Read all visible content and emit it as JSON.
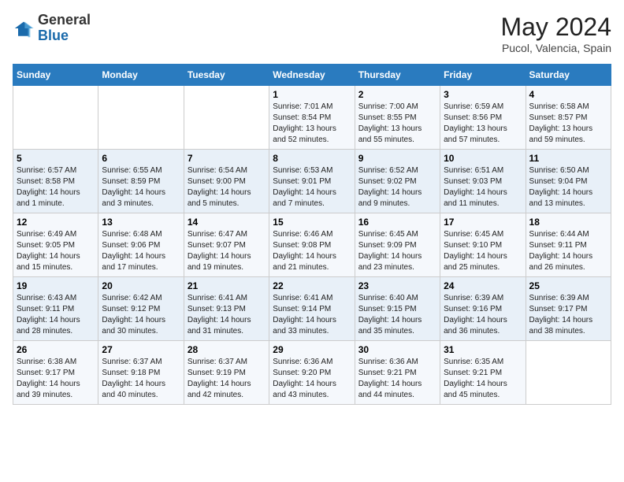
{
  "header": {
    "logo": {
      "general": "General",
      "blue": "Blue"
    },
    "title": "May 2024",
    "location": "Pucol, Valencia, Spain"
  },
  "weekdays": [
    "Sunday",
    "Monday",
    "Tuesday",
    "Wednesday",
    "Thursday",
    "Friday",
    "Saturday"
  ],
  "weeks": [
    [
      null,
      null,
      null,
      {
        "day": "1",
        "sunrise": "7:01 AM",
        "sunset": "8:54 PM",
        "daylight": "13 hours and 52 minutes."
      },
      {
        "day": "2",
        "sunrise": "7:00 AM",
        "sunset": "8:55 PM",
        "daylight": "13 hours and 55 minutes."
      },
      {
        "day": "3",
        "sunrise": "6:59 AM",
        "sunset": "8:56 PM",
        "daylight": "13 hours and 57 minutes."
      },
      {
        "day": "4",
        "sunrise": "6:58 AM",
        "sunset": "8:57 PM",
        "daylight": "13 hours and 59 minutes."
      }
    ],
    [
      {
        "day": "5",
        "sunrise": "6:57 AM",
        "sunset": "8:58 PM",
        "daylight": "14 hours and 1 minute."
      },
      {
        "day": "6",
        "sunrise": "6:55 AM",
        "sunset": "8:59 PM",
        "daylight": "14 hours and 3 minutes."
      },
      {
        "day": "7",
        "sunrise": "6:54 AM",
        "sunset": "9:00 PM",
        "daylight": "14 hours and 5 minutes."
      },
      {
        "day": "8",
        "sunrise": "6:53 AM",
        "sunset": "9:01 PM",
        "daylight": "14 hours and 7 minutes."
      },
      {
        "day": "9",
        "sunrise": "6:52 AM",
        "sunset": "9:02 PM",
        "daylight": "14 hours and 9 minutes."
      },
      {
        "day": "10",
        "sunrise": "6:51 AM",
        "sunset": "9:03 PM",
        "daylight": "14 hours and 11 minutes."
      },
      {
        "day": "11",
        "sunrise": "6:50 AM",
        "sunset": "9:04 PM",
        "daylight": "14 hours and 13 minutes."
      }
    ],
    [
      {
        "day": "12",
        "sunrise": "6:49 AM",
        "sunset": "9:05 PM",
        "daylight": "14 hours and 15 minutes."
      },
      {
        "day": "13",
        "sunrise": "6:48 AM",
        "sunset": "9:06 PM",
        "daylight": "14 hours and 17 minutes."
      },
      {
        "day": "14",
        "sunrise": "6:47 AM",
        "sunset": "9:07 PM",
        "daylight": "14 hours and 19 minutes."
      },
      {
        "day": "15",
        "sunrise": "6:46 AM",
        "sunset": "9:08 PM",
        "daylight": "14 hours and 21 minutes."
      },
      {
        "day": "16",
        "sunrise": "6:45 AM",
        "sunset": "9:09 PM",
        "daylight": "14 hours and 23 minutes."
      },
      {
        "day": "17",
        "sunrise": "6:45 AM",
        "sunset": "9:10 PM",
        "daylight": "14 hours and 25 minutes."
      },
      {
        "day": "18",
        "sunrise": "6:44 AM",
        "sunset": "9:11 PM",
        "daylight": "14 hours and 26 minutes."
      }
    ],
    [
      {
        "day": "19",
        "sunrise": "6:43 AM",
        "sunset": "9:11 PM",
        "daylight": "14 hours and 28 minutes."
      },
      {
        "day": "20",
        "sunrise": "6:42 AM",
        "sunset": "9:12 PM",
        "daylight": "14 hours and 30 minutes."
      },
      {
        "day": "21",
        "sunrise": "6:41 AM",
        "sunset": "9:13 PM",
        "daylight": "14 hours and 31 minutes."
      },
      {
        "day": "22",
        "sunrise": "6:41 AM",
        "sunset": "9:14 PM",
        "daylight": "14 hours and 33 minutes."
      },
      {
        "day": "23",
        "sunrise": "6:40 AM",
        "sunset": "9:15 PM",
        "daylight": "14 hours and 35 minutes."
      },
      {
        "day": "24",
        "sunrise": "6:39 AM",
        "sunset": "9:16 PM",
        "daylight": "14 hours and 36 minutes."
      },
      {
        "day": "25",
        "sunrise": "6:39 AM",
        "sunset": "9:17 PM",
        "daylight": "14 hours and 38 minutes."
      }
    ],
    [
      {
        "day": "26",
        "sunrise": "6:38 AM",
        "sunset": "9:17 PM",
        "daylight": "14 hours and 39 minutes."
      },
      {
        "day": "27",
        "sunrise": "6:37 AM",
        "sunset": "9:18 PM",
        "daylight": "14 hours and 40 minutes."
      },
      {
        "day": "28",
        "sunrise": "6:37 AM",
        "sunset": "9:19 PM",
        "daylight": "14 hours and 42 minutes."
      },
      {
        "day": "29",
        "sunrise": "6:36 AM",
        "sunset": "9:20 PM",
        "daylight": "14 hours and 43 minutes."
      },
      {
        "day": "30",
        "sunrise": "6:36 AM",
        "sunset": "9:21 PM",
        "daylight": "14 hours and 44 minutes."
      },
      {
        "day": "31",
        "sunrise": "6:35 AM",
        "sunset": "9:21 PM",
        "daylight": "14 hours and 45 minutes."
      },
      null
    ]
  ]
}
